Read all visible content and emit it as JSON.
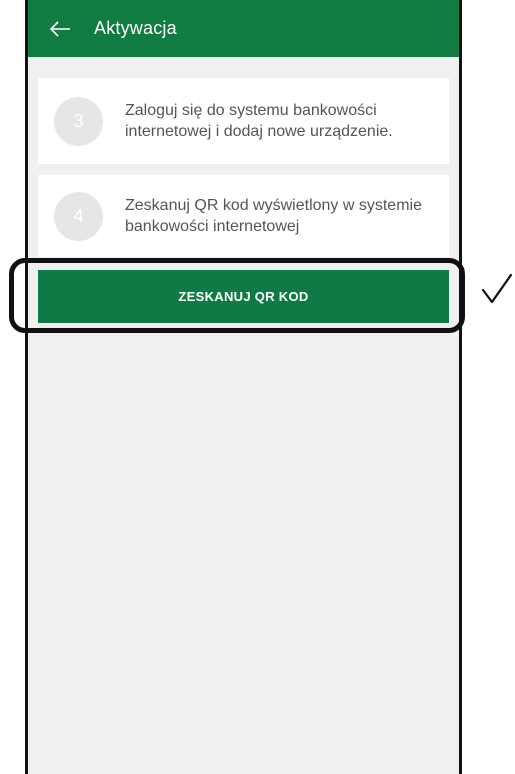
{
  "appbar": {
    "title": "Aktywacja",
    "back_icon": "arrow-left-icon"
  },
  "steps": [
    {
      "number": "3",
      "text": "Zaloguj się do systemu bankowości internetowej i dodaj nowe urządzenie."
    },
    {
      "number": "4",
      "text": "Zeskanuj QR kod wyświetlony w systemie bankowości internetowej"
    }
  ],
  "action": {
    "label": "ZESKANUJ QR KOD"
  },
  "annotation": {
    "mark": "✓"
  },
  "colors": {
    "primary_green": "#107c41",
    "button_green": "#0f7a45",
    "background": "#f0f0f0",
    "step_circle": "#e6e6e6",
    "step_text": "#555555"
  }
}
